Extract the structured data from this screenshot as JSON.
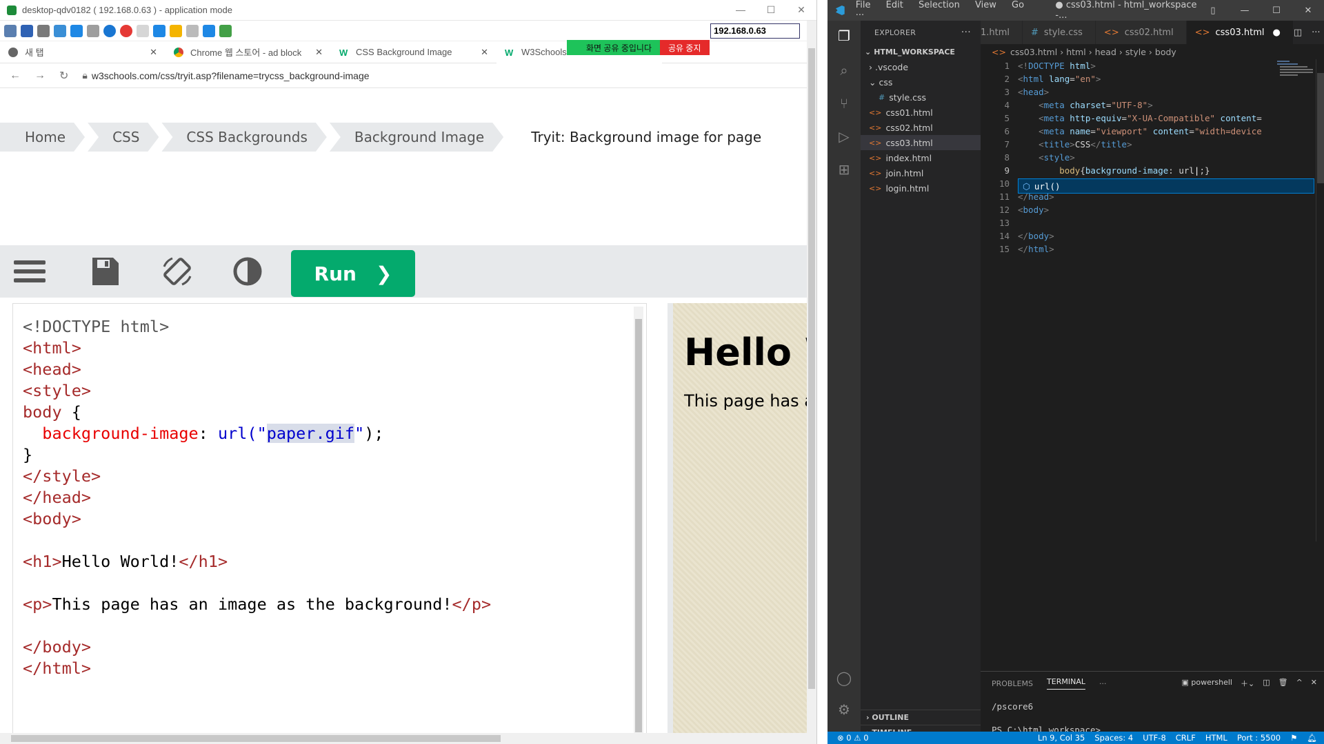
{
  "remote": {
    "title": "desktop-qdv0182 ( 192.168.0.63 ) - application mode",
    "ip": "192.168.0.63"
  },
  "browser": {
    "tabs": [
      {
        "label": "새 탭"
      },
      {
        "label": "Chrome 웹 스토어 - ad block"
      },
      {
        "label": "CSS Background Image"
      },
      {
        "label": "W3Schools"
      }
    ],
    "share_banner": "화면 공유 중입니다",
    "stop_share": "공유 중지",
    "url": "w3schools.com/css/tryit.asp?filename=trycss_background-image"
  },
  "w3": {
    "breadcrumbs": [
      "Home",
      "CSS",
      "CSS Backgrounds",
      "Background Image",
      "Tryit: Background image for page"
    ],
    "run_label": "Run",
    "result_h1": "Hello World!",
    "result_p": "This page has an image as the background!"
  },
  "vscode": {
    "menu": [
      "File",
      "Edit",
      "Selection",
      "View",
      "Go",
      "···"
    ],
    "window_title": "● css03.html - html_workspace -...",
    "explorer_title": "EXPLORER",
    "workspace": "HTML_WORKSPACE",
    "tree": [
      {
        "label": ".vscode",
        "kind": "folder",
        "indent": 1
      },
      {
        "label": "css",
        "kind": "folder-open",
        "indent": 1
      },
      {
        "label": "style.css",
        "kind": "css",
        "indent": 2
      },
      {
        "label": "css01.html",
        "kind": "html",
        "indent": 1
      },
      {
        "label": "css02.html",
        "kind": "html",
        "indent": 1
      },
      {
        "label": "css03.html",
        "kind": "html",
        "indent": 1,
        "selected": true
      },
      {
        "label": "index.html",
        "kind": "html",
        "indent": 1
      },
      {
        "label": "join.html",
        "kind": "html",
        "indent": 1
      },
      {
        "label": "login.html",
        "kind": "html",
        "indent": 1
      }
    ],
    "outline": "OUTLINE",
    "timeline": "TIMELINE",
    "tabs": [
      "1.html",
      "style.css",
      "css02.html",
      "css03.html"
    ],
    "breadcrumb": [
      "css03.html",
      "html",
      "head",
      "style",
      "body"
    ],
    "suggest": "url()",
    "panel_tabs": [
      "PROBLEMS",
      "TERMINAL"
    ],
    "shell": "powershell",
    "terminal_lines": [
      "/pscore6",
      "PS C:\\html_workspace>"
    ],
    "status": {
      "errors": "⊗ 0 ⚠ 0",
      "position": "Ln 9, Col 35",
      "spaces": "Spaces: 4",
      "encoding": "UTF-8",
      "eol": "CRLF",
      "lang": "HTML",
      "port": "Port : 5500"
    }
  }
}
